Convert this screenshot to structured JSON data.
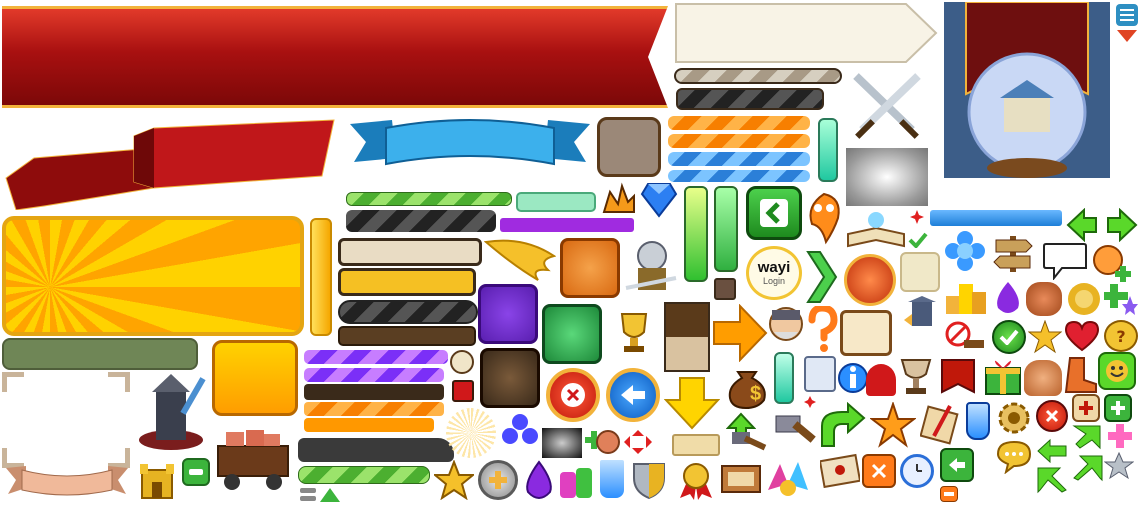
{
  "login_badge": {
    "brand": "wayi",
    "label": "Login"
  },
  "colors": {
    "ribbon_red": "#b81616",
    "ribbon_blue": "#2b9be0",
    "panel_orange": "#ffb400",
    "green_button": "#3cb43c",
    "orange_square": "#ff9d00",
    "cream_panel": "#f7f1e3",
    "gold_border": "#f2b33b"
  },
  "icons": [
    "sword-crossed-icon",
    "crystal-ball-icon",
    "menu-icon",
    "arrow-down-icon",
    "diamond-icon",
    "fire-icon",
    "wing-icon",
    "knight-icon",
    "trophy-icon",
    "close-icon",
    "back-arrow-icon",
    "chevron-left-icon",
    "chevron-right-icon",
    "check-icon",
    "star-icon",
    "heart-icon",
    "question-icon",
    "gift-icon",
    "chest-icon",
    "plus-icon",
    "minus-icon",
    "gear-icon",
    "clock-icon",
    "shield-icon",
    "potion-icon",
    "hammer-icon",
    "money-bag-icon",
    "scroll-icon",
    "tower-icon",
    "flower-icon",
    "signpost-icon",
    "speech-bubble-icon",
    "smile-icon"
  ]
}
